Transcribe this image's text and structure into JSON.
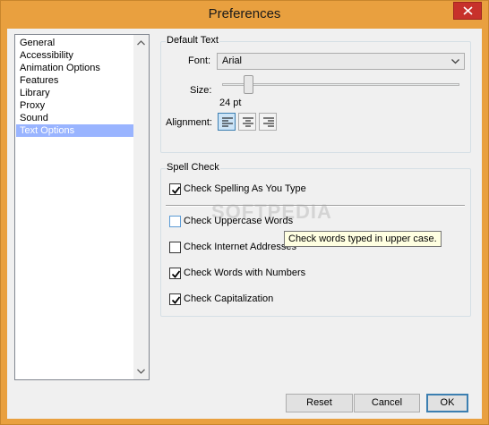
{
  "window": {
    "title": "Preferences"
  },
  "sidebar": {
    "items": [
      {
        "label": "General"
      },
      {
        "label": "Accessibility"
      },
      {
        "label": "Animation Options"
      },
      {
        "label": "Features"
      },
      {
        "label": "Library"
      },
      {
        "label": "Proxy"
      },
      {
        "label": "Sound"
      },
      {
        "label": "Text Options"
      }
    ],
    "selected": "Text Options"
  },
  "default_text": {
    "group_title": "Default Text",
    "font_label": "Font:",
    "font_value": "Arial",
    "size_label": "Size:",
    "size_value": "24 pt",
    "alignment_label": "Alignment:",
    "alignment_selected": "left"
  },
  "spell_check": {
    "group_title": "Spell Check",
    "check_spelling": {
      "label": "Check Spelling As You Type",
      "checked": true
    },
    "options": [
      {
        "label": "Check Uppercase Words",
        "checked": false
      },
      {
        "label": "Check Internet Addresses",
        "checked": false
      },
      {
        "label": "Check Words with Numbers",
        "checked": true
      },
      {
        "label": "Check Capitalization",
        "checked": true
      }
    ]
  },
  "tooltip": {
    "text": "Check words typed in upper case."
  },
  "watermark": {
    "text": "SOFTPEDIA"
  },
  "buttons": {
    "reset": "Reset",
    "cancel": "Cancel",
    "ok": "OK"
  },
  "colors": {
    "titlebar": "#e9a03f",
    "close": "#c7312b",
    "selection": "#99b4ff"
  }
}
